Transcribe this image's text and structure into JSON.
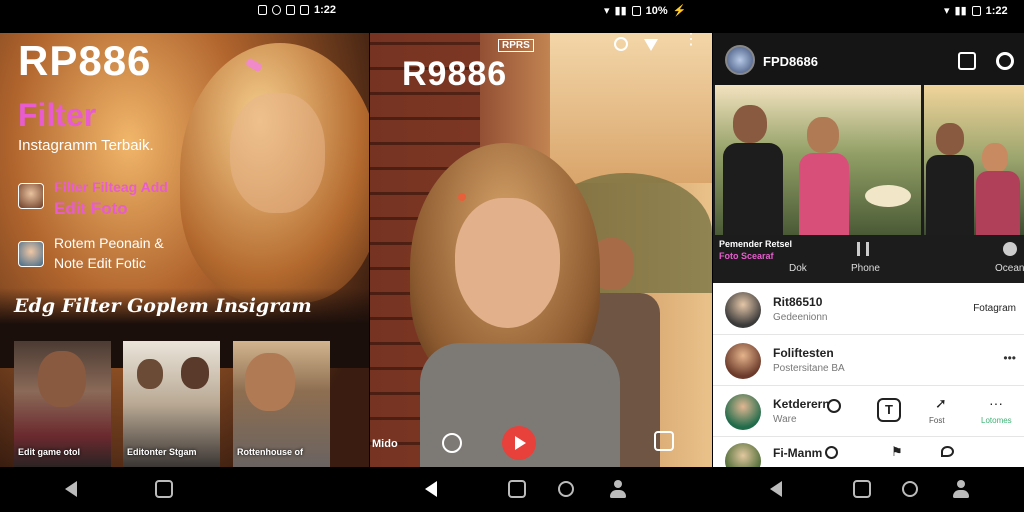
{
  "status_bar": {
    "left_time": "1:22",
    "mid_battery": "10%",
    "right_time": "1:22"
  },
  "left_panel": {
    "brand": "RP886",
    "filter_title": "Filter",
    "subtitle": "Instagramm Terbaik.",
    "feature1_line1": "Filter Filteag Add",
    "feature1_line2": "Edit Foto",
    "feature2_line1": "Rotem Peonain &",
    "feature2_line2": "Note Edit Fotic",
    "section_title": "Edg Filter Goplem Insigram",
    "thumbs": [
      {
        "label": "Edit game otol"
      },
      {
        "label": "Editonter Stgam"
      },
      {
        "label": "Rottenhouse of"
      }
    ]
  },
  "mid_panel": {
    "brand": "R9886",
    "badge": "RPRS",
    "bottom_left_text": "Mido"
  },
  "right_panel": {
    "profile_name": "FPD8686",
    "photo_caption_line1": "Pemender Retsel",
    "photo_caption_line2": "Foto Scearaf",
    "tabs": [
      {
        "label": "Dok"
      },
      {
        "label": "Phone"
      },
      {
        "label": "Ocean"
      }
    ],
    "list": [
      {
        "title": "Rit86510",
        "subtitle": "Gedeenionn",
        "action": "Fotagram"
      },
      {
        "title": "Foliftesten",
        "subtitle": "Postersitane BA",
        "action": "•••"
      },
      {
        "title": "Ketderern",
        "subtitle": "Ware",
        "action_labels": [
          "Fost",
          "Lotomes"
        ]
      },
      {
        "title": "Fi-Manm",
        "subtitle": "",
        "action": ""
      }
    ]
  },
  "colors": {
    "accent_pink": "#e85ccf",
    "play_red": "#e8403a",
    "active_green": "#3bb273"
  }
}
